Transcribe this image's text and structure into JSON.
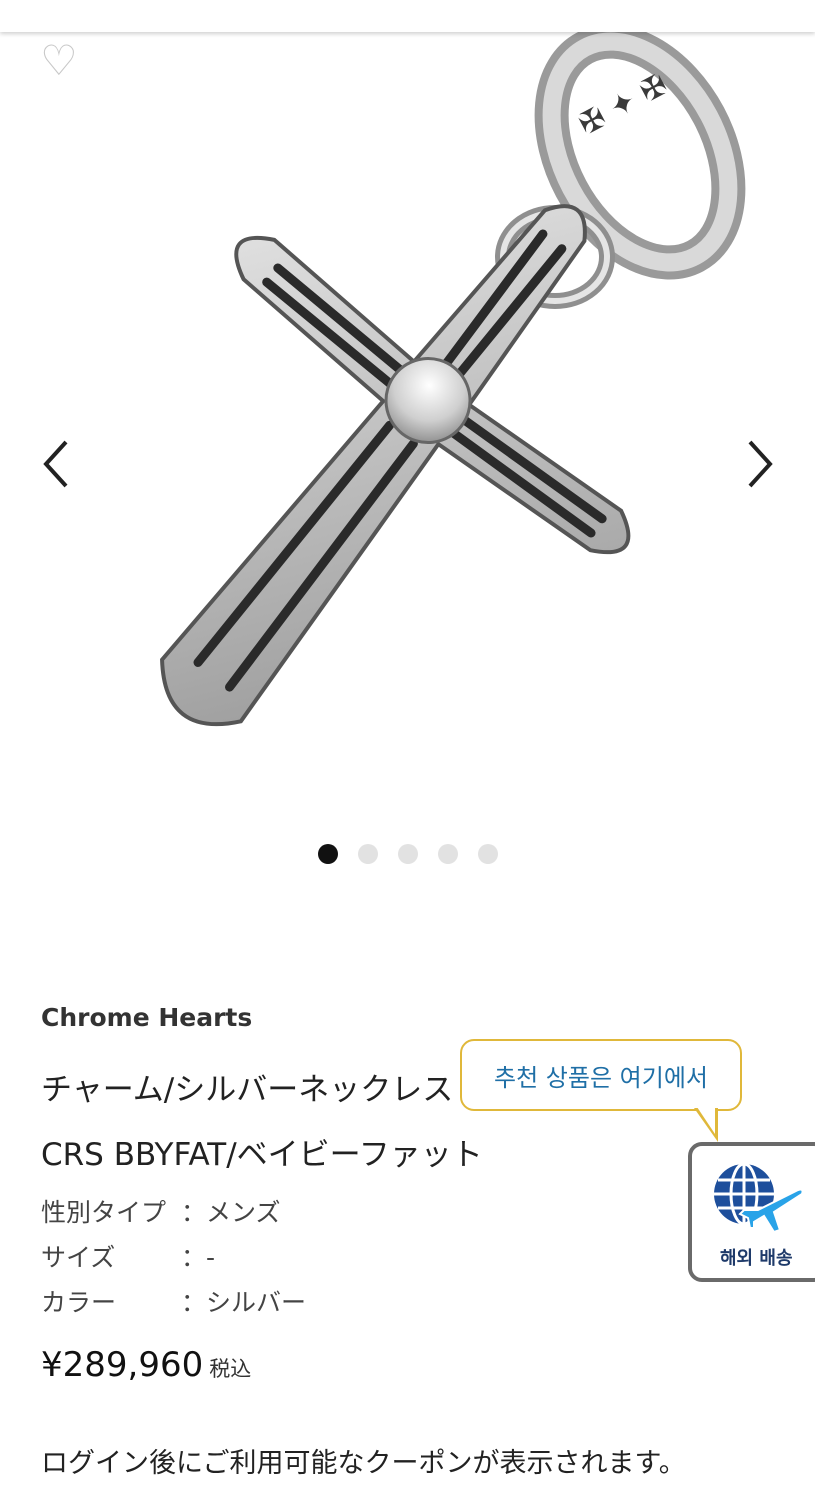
{
  "gallery": {
    "product_image": "chrome-hearts-cross-pendant",
    "slide_count": 5,
    "active_slide": 1
  },
  "product": {
    "brand": "Chrome Hearts",
    "name_line1": "チャーム/シルバーネックレス",
    "name_line2": "CRS BBYFAT/ベイビーファット",
    "attributes": [
      {
        "key": "性別タイプ",
        "value": "：メンズ"
      },
      {
        "key": "サイズ",
        "value": "：-"
      },
      {
        "key": "カラー",
        "value": "：シルバー"
      }
    ],
    "price": "¥289,960",
    "tax_label": "税込",
    "coupon_notice": "ログイン後にご利用可能なクーポンが表示されます。"
  },
  "tooltip": {
    "text": "추천 상품은 여기에서"
  },
  "shipping_button": {
    "label": "해외 배송"
  },
  "icons": {
    "favorite": "heart-outline-icon",
    "prev": "chevron-left-icon",
    "next": "chevron-right-icon",
    "shipping": "globe-airplane-icon"
  },
  "colors": {
    "tooltip_border": "#e0b83a",
    "tooltip_text": "#1f6fa6",
    "shipping_blue": "#1e88e5"
  }
}
